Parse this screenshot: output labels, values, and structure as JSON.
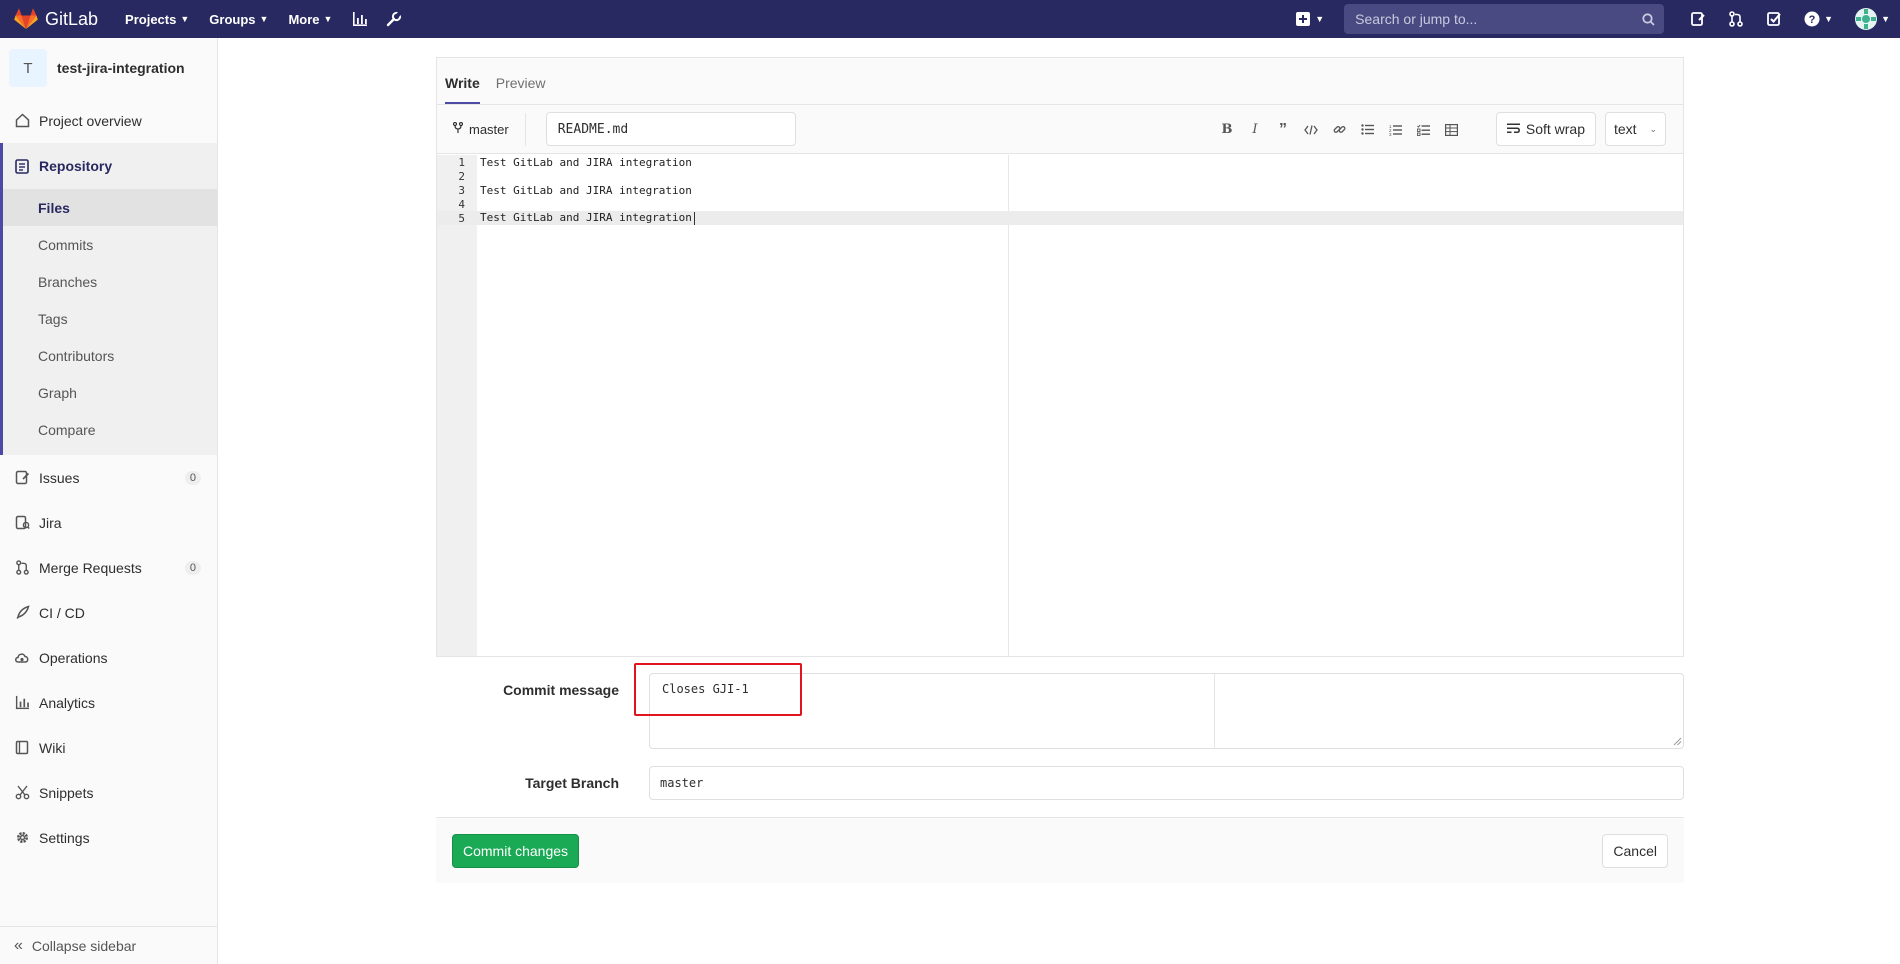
{
  "navbar": {
    "brand": "GitLab",
    "links": [
      {
        "label": "Projects"
      },
      {
        "label": "Groups"
      },
      {
        "label": "More"
      }
    ],
    "search_placeholder": "Search or jump to..."
  },
  "sidebar": {
    "project_avatar": "T",
    "project_name": "test-jira-integration",
    "project_overview": "Project overview",
    "repository": "Repository",
    "repo_items": [
      "Files",
      "Commits",
      "Branches",
      "Tags",
      "Contributors",
      "Graph",
      "Compare"
    ],
    "issues": "Issues",
    "issues_count": "0",
    "jira": "Jira",
    "merge_requests": "Merge Requests",
    "merge_requests_count": "0",
    "cicd": "CI / CD",
    "operations": "Operations",
    "analytics": "Analytics",
    "wiki": "Wiki",
    "snippets": "Snippets",
    "settings": "Settings",
    "collapse": "Collapse sidebar"
  },
  "editor": {
    "tabs": {
      "write": "Write",
      "preview": "Preview"
    },
    "branch": "master",
    "file_name": "README.md",
    "soft_wrap": "Soft wrap",
    "language": "text",
    "lines": [
      {
        "num": "1",
        "text": "Test GitLab and JIRA integration"
      },
      {
        "num": "2",
        "text": ""
      },
      {
        "num": "3",
        "text": "Test GitLab and JIRA integration"
      },
      {
        "num": "4",
        "text": ""
      },
      {
        "num": "5",
        "text": "Test GitLab and JIRA integration"
      }
    ]
  },
  "form": {
    "commit_message_label": "Commit message",
    "commit_message": "Closes GJI-1",
    "target_branch_label": "Target Branch",
    "target_branch": "master",
    "commit_button": "Commit changes",
    "cancel_button": "Cancel"
  },
  "colors": {
    "navbar": "#292961",
    "commit_button": "#1aaa55",
    "highlight": "#e0141e"
  }
}
